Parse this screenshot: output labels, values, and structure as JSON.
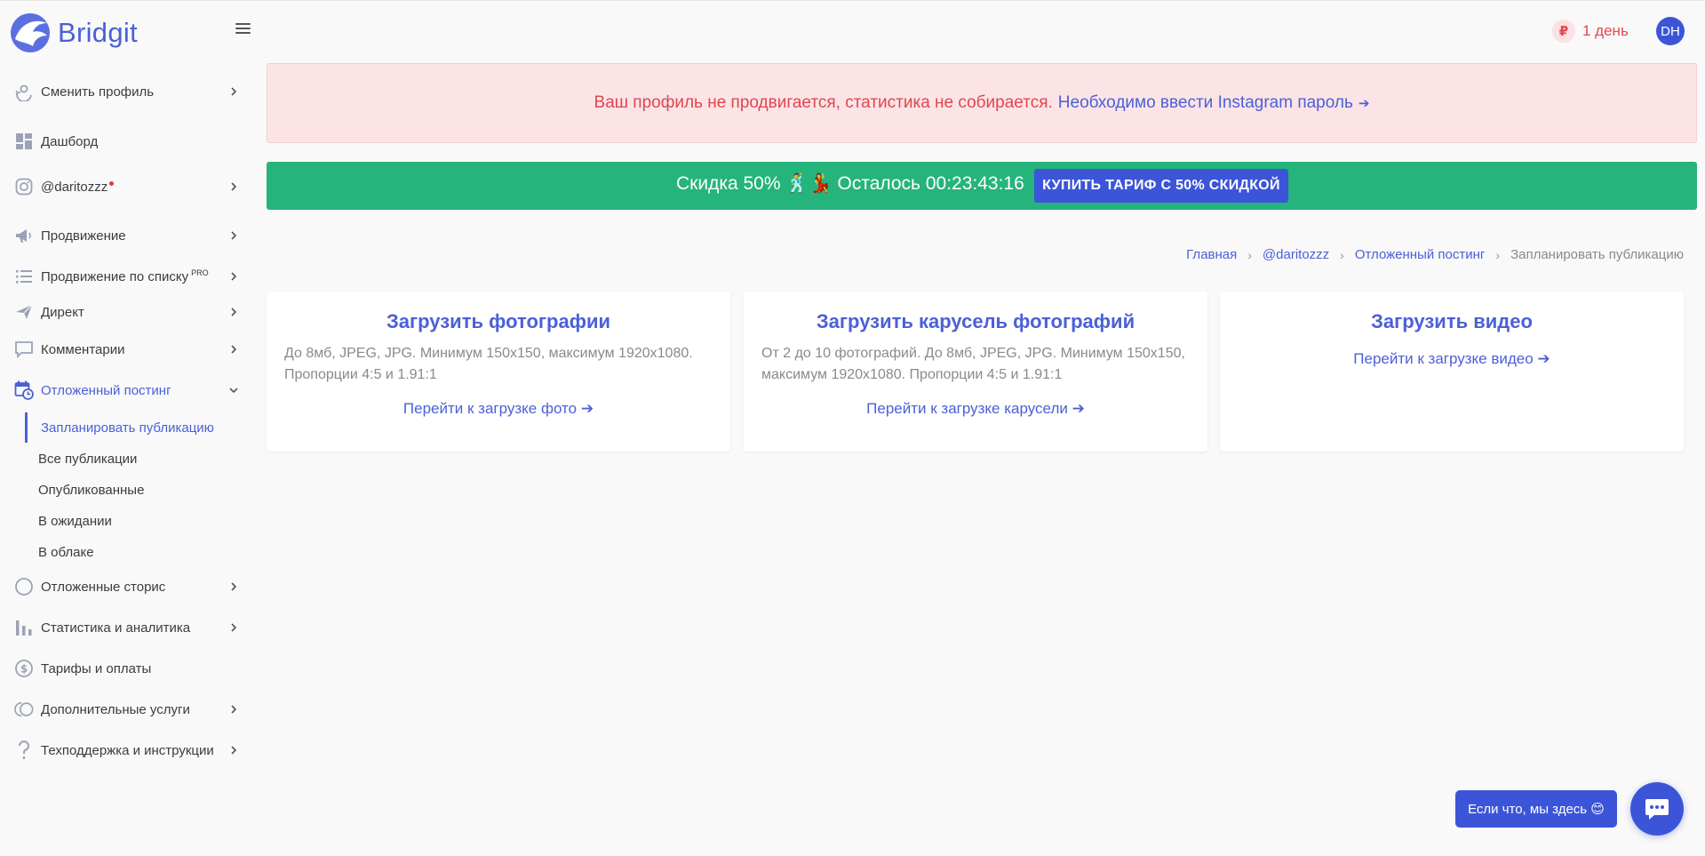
{
  "brand": {
    "name": "Bridgit"
  },
  "sidebar": {
    "items": [
      {
        "id": "switch-profile",
        "label": "Сменить профиль",
        "icon": "switch-profile-icon",
        "chevron": true
      },
      {
        "id": "dashboard",
        "label": "Дашборд",
        "icon": "dashboard-icon",
        "chevron": false
      },
      {
        "id": "instagram-account",
        "label": "@daritozzz",
        "icon": "instagram-icon",
        "chevron": true
      },
      {
        "id": "promotion",
        "label": "Продвижение",
        "icon": "megaphone-icon",
        "chevron": true
      },
      {
        "id": "promotion-list",
        "label": "Продвижение по списку",
        "sup": "PRO",
        "icon": "list-icon",
        "chevron": true
      },
      {
        "id": "direct",
        "label": "Директ",
        "icon": "paper-plane-icon",
        "chevron": true
      },
      {
        "id": "comments",
        "label": "Комментарии",
        "icon": "comment-icon",
        "chevron": true
      },
      {
        "id": "scheduled-posting",
        "label": "Отложенный постинг",
        "icon": "calendar-clock-icon",
        "chevron": true
      },
      {
        "id": "scheduled-stories",
        "label": "Отложенные сторис",
        "icon": "circle-icon",
        "chevron": true
      },
      {
        "id": "stats",
        "label": "Статистика и аналитика",
        "icon": "bar-chart-icon",
        "chevron": true
      },
      {
        "id": "tariffs",
        "label": "Тарифы и оплаты",
        "icon": "dollar-circle-icon",
        "chevron": false
      },
      {
        "id": "extra-services",
        "label": "Дополнительные услуги",
        "icon": "extra-services-icon",
        "chevron": true
      },
      {
        "id": "support",
        "label": "Техподдержка и инструкции",
        "icon": "question-icon",
        "chevron": true
      }
    ],
    "subitems": [
      {
        "label": "Запланировать публикацию",
        "active": true
      },
      {
        "label": "Все публикации",
        "active": false
      },
      {
        "label": "Опубликованные",
        "active": false
      },
      {
        "label": "В ожидании",
        "active": false
      },
      {
        "label": "В облаке",
        "active": false
      }
    ]
  },
  "topbar": {
    "currency_symbol": "₽",
    "days_left": "1 день",
    "avatar_initials": "DH"
  },
  "alert": {
    "warning_text": "Ваш профиль не продвигается, статистика не собирается.",
    "link_text": "Необходимо ввести Instagram пароль",
    "link_arrow": "➔"
  },
  "promo": {
    "text": "Скидка 50% 🕺💃 Осталось 00:23:43:16",
    "button_label": "КУПИТЬ ТАРИФ С 50% СКИДКОЙ"
  },
  "breadcrumb": [
    {
      "label": "Главная",
      "current": false
    },
    {
      "label": "@daritozzz",
      "current": false
    },
    {
      "label": "Отложенный постинг",
      "current": false
    },
    {
      "label": "Запланировать публикацию",
      "current": true
    }
  ],
  "cards": [
    {
      "title": "Загрузить фотографии",
      "description": "До 8мб, JPEG, JPG. Минимум 150x150, максимум 1920x1080. Пропорции 4:5 и 1.91:1",
      "link": "Перейти к загрузке фото ➔"
    },
    {
      "title": "Загрузить карусель фотографий",
      "description": "От 2 до 10 фотографий. До 8мб, JPEG, JPG. Минимум 150x150, максимум 1920x1080. Пропорции 4:5 и 1.91:1",
      "link": "Перейти к загрузке карусели ➔"
    },
    {
      "title": "Загрузить видео",
      "description": "",
      "link": "Перейти к загрузке видео ➔"
    }
  ],
  "chat": {
    "bubble_text": "Если что, мы здесь 😊"
  },
  "colors": {
    "accent": "#4b60d8",
    "promo": "#25b47c",
    "alert_bg": "#fce4e6",
    "warning": "#e0464c"
  }
}
